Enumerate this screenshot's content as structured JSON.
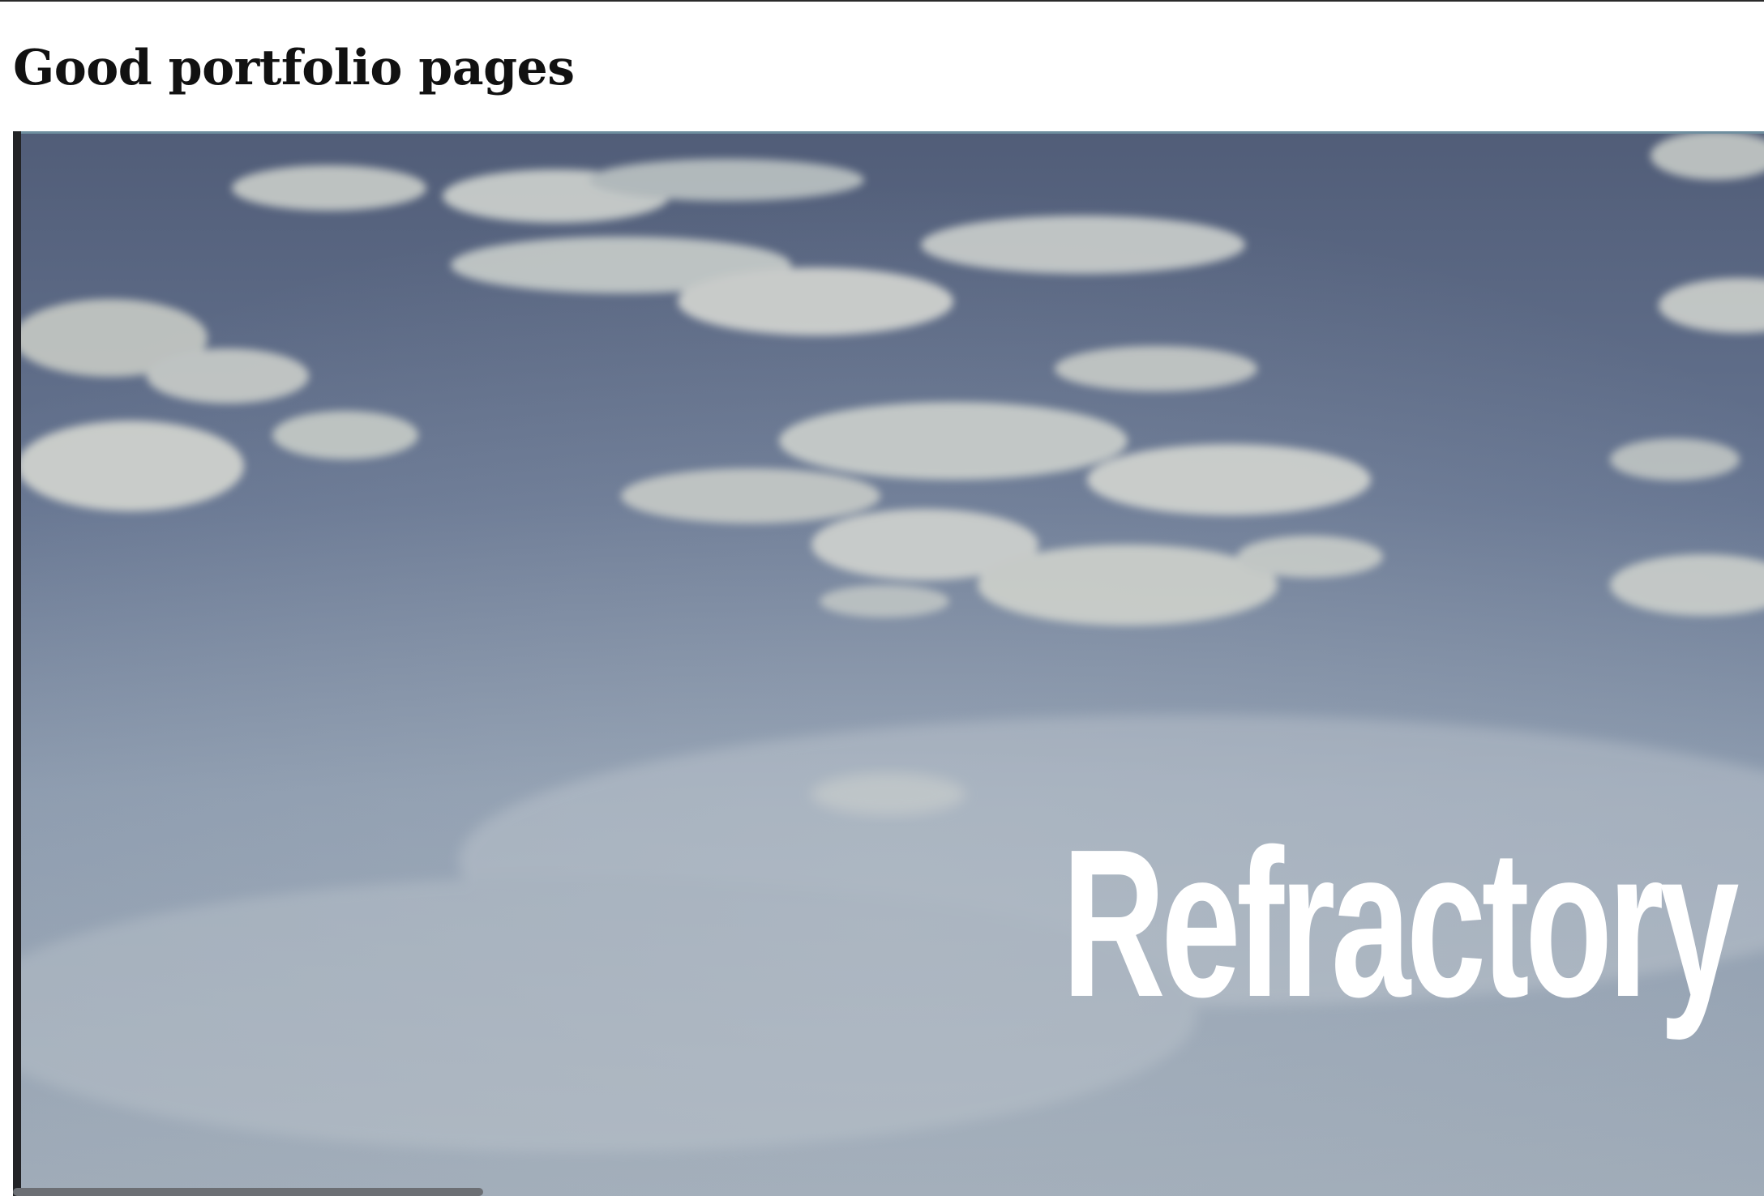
{
  "page": {
    "title": "Good portfolio pages"
  },
  "hero": {
    "title": "Refractory",
    "image_name": "sky-with-clouds-image"
  },
  "colors": {
    "background": "#ffffff",
    "title_text": "#111111",
    "hero_text": "#ffffff",
    "sky_top": "#515d78",
    "sky_bottom": "#9eaab7",
    "scrollbar": "#6c6f74"
  }
}
